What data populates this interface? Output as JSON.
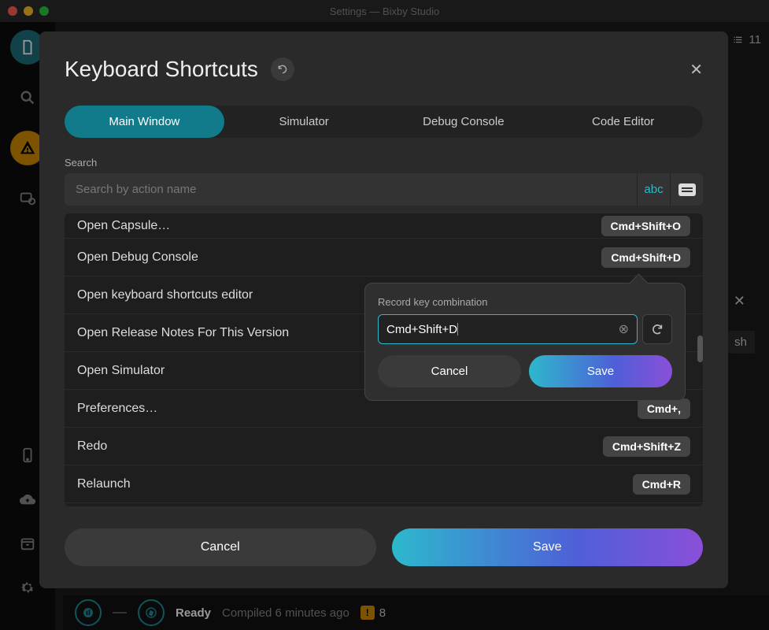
{
  "window_title": "Settings — Bixby Studio",
  "top_right": {
    "count": "11"
  },
  "right_panel": {
    "refresh_text": "sh"
  },
  "status": {
    "ready": "Ready",
    "compiled": "Compiled 6 minutes ago",
    "warn_count": "8"
  },
  "modal": {
    "title": "Keyboard Shortcuts",
    "tabs": [
      {
        "label": "Main Window",
        "active": true
      },
      {
        "label": "Simulator"
      },
      {
        "label": "Debug Console"
      },
      {
        "label": "Code Editor"
      }
    ],
    "search_label": "Search",
    "search_placeholder": "Search by action name",
    "search_toggle_text": "abc",
    "shortcuts": [
      {
        "action": "Open Capsule…",
        "key": "Cmd+Shift+O"
      },
      {
        "action": "Open Debug Console",
        "key": "Cmd+Shift+D"
      },
      {
        "action": "Open keyboard shortcuts editor",
        "key": ""
      },
      {
        "action": "Open Release Notes For This Version",
        "key": ""
      },
      {
        "action": "Open Simulator",
        "key": ""
      },
      {
        "action": "Preferences…",
        "key": "Cmd+,"
      },
      {
        "action": "Redo",
        "key": "Cmd+Shift+Z"
      },
      {
        "action": "Relaunch",
        "key": "Cmd+R"
      }
    ],
    "cancel": "Cancel",
    "save": "Save"
  },
  "popover": {
    "label": "Record key combination",
    "value": "Cmd+Shift+D",
    "cancel": "Cancel",
    "save": "Save"
  }
}
